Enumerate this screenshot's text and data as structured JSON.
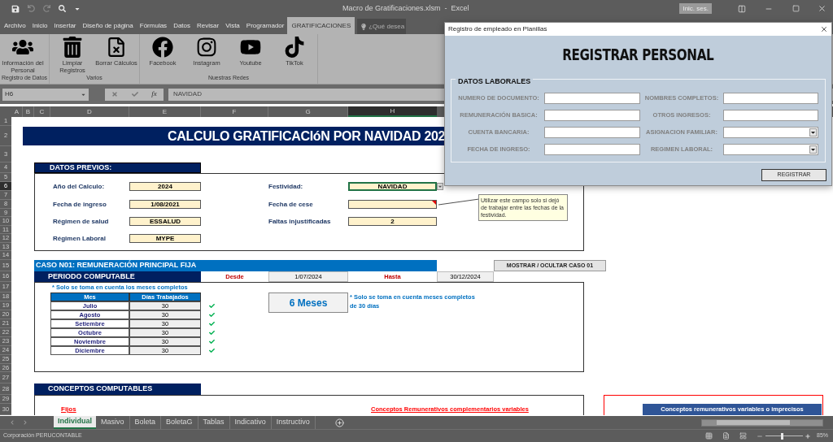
{
  "window": {
    "title": "Macro de Gratificaciones.xlsm  -  Excel",
    "sign_in": "Inic. ses."
  },
  "menu": [
    {
      "label": "Archivo",
      "selected": false
    },
    {
      "label": "Inicio",
      "selected": false
    },
    {
      "label": "Insertar",
      "selected": false
    },
    {
      "label": "Diseño de página",
      "selected": false
    },
    {
      "label": "Fórmulas",
      "selected": false
    },
    {
      "label": "Datos",
      "selected": false
    },
    {
      "label": "Revisar",
      "selected": false
    },
    {
      "label": "Vista",
      "selected": false
    },
    {
      "label": "Programador",
      "selected": false
    },
    {
      "label": "GRATIFICACIONES",
      "selected": true
    }
  ],
  "search": {
    "placeholder": "¿Qué desea"
  },
  "ribbon": [
    {
      "label": "Registro de Datos",
      "buttons": [
        {
          "label": "Información del Personal",
          "kind": "people"
        }
      ]
    },
    {
      "label": "Varios",
      "buttons": [
        {
          "label": "Limpiar Registros",
          "kind": "trash"
        },
        {
          "label": "Borrar Cálculos",
          "kind": "erase"
        }
      ]
    },
    {
      "label": "Nuestras Redes",
      "buttons": [
        {
          "label": "Facebook",
          "kind": "facebook"
        },
        {
          "label": "Instagram",
          "kind": "instagram"
        },
        {
          "label": "Youtube",
          "kind": "youtube"
        },
        {
          "label": "TikTok",
          "kind": "tiktok"
        }
      ]
    }
  ],
  "formula_bar": {
    "name_box": "H6",
    "function_label": "fx",
    "value": "NAVIDAD"
  },
  "columns": [
    {
      "label": "A",
      "selected": false
    },
    {
      "label": "B",
      "selected": false
    },
    {
      "label": "C",
      "selected": false
    },
    {
      "label": "D",
      "selected": false
    },
    {
      "label": "E",
      "selected": false
    },
    {
      "label": "F",
      "selected": false
    },
    {
      "label": "G",
      "selected": false
    },
    {
      "label": "H",
      "selected": true
    }
  ],
  "rows": [
    {
      "label": "1",
      "selected": false
    },
    {
      "label": "2",
      "selected": false
    },
    {
      "label": "3",
      "selected": false
    },
    {
      "label": "4",
      "selected": false
    },
    {
      "label": "5",
      "selected": false
    },
    {
      "label": "6",
      "selected": true
    },
    {
      "label": "7",
      "selected": false
    },
    {
      "label": "8",
      "selected": false
    },
    {
      "label": "9",
      "selected": false
    },
    {
      "label": "10",
      "selected": false
    },
    {
      "label": "11",
      "selected": false
    },
    {
      "label": "12",
      "selected": false
    },
    {
      "label": "13",
      "selected": false
    },
    {
      "label": "14",
      "selected": false
    },
    {
      "label": "15",
      "selected": false
    },
    {
      "label": "16",
      "selected": false
    },
    {
      "label": "17",
      "selected": false
    },
    {
      "label": "18",
      "selected": false
    },
    {
      "label": "19",
      "selected": false
    },
    {
      "label": "20",
      "selected": false
    },
    {
      "label": "21",
      "selected": false
    },
    {
      "label": "22",
      "selected": false
    },
    {
      "label": "23",
      "selected": false
    },
    {
      "label": "24",
      "selected": false
    },
    {
      "label": "25",
      "selected": false
    },
    {
      "label": "26",
      "selected": false
    },
    {
      "label": "27",
      "selected": false
    },
    {
      "label": "28",
      "selected": false
    },
    {
      "label": "29",
      "selected": false
    },
    {
      "label": "30",
      "selected": false
    }
  ],
  "sheet": {
    "banner": "CALCULO GRATIFICACIóN POR NAVIDAD 202",
    "datos_previos": {
      "heading": "DATOS PREVIOS:",
      "left": [
        {
          "label": "Año del Calculo:",
          "value": "2024",
          "selected": false
        },
        {
          "label": "Fecha de ingreso",
          "value": "1/08/2021",
          "selected": false
        },
        {
          "label": "Régimen de salud",
          "value": "ESSALUD",
          "selected": false
        },
        {
          "label": "Régimen Laboral",
          "value": "MYPE",
          "selected": false
        }
      ],
      "right": [
        {
          "label": "Festividad:",
          "value": "NAVIDAD",
          "selected": true,
          "dropdown": true
        },
        {
          "label": "Fecha de cese",
          "selected": false,
          "comment": "Utilizar este campo solo si dejó de trabajar entre las fechas de la festividad."
        },
        {
          "label": "Faltas injustificadas",
          "value": "2",
          "selected": false
        }
      ]
    },
    "caso": {
      "heading": "CASO N01: REMUNERACIÓN PRINCIPAL FIJA",
      "toggle_button": "MOSTRAR / OCULTAR CASO 01",
      "period_heading": "PERIODO COMPUTABLE",
      "from_label": "Desde",
      "from": "1/07/2024",
      "to_label": "Hasta",
      "to": "30/12/2024",
      "note": "* Solo se toma en cuenta los meses completos",
      "table_columns": [
        "Mes",
        "Días Trabajados"
      ],
      "table_rows": [
        {
          "month": "Julio",
          "days": "30",
          "checked": true
        },
        {
          "month": "Agosto",
          "days": "30",
          "checked": true
        },
        {
          "month": "Setiembre",
          "days": "30",
          "checked": true
        },
        {
          "month": "Octubre",
          "days": "30",
          "checked": true
        },
        {
          "month": "Noviembre",
          "days": "30",
          "checked": true
        },
        {
          "month": "Diciembre",
          "days": "30",
          "checked": true
        }
      ],
      "months_total": "6 Meses",
      "total_note": "* Solo se toma en cuenta meses completos de 30 días"
    },
    "conceptos": {
      "heading": "CONCEPTOS COMPUTABLES",
      "fixed_label": "Fijos",
      "variable_label": "Conceptos Remunerativos complementarios variables",
      "side_table_title": "Conceptos remunerativos variables o imprecisos"
    }
  },
  "sheet_tabs": [
    {
      "label": "Individual",
      "selected": true
    },
    {
      "label": "Masivo",
      "selected": false
    },
    {
      "label": "Boleta",
      "selected": false
    },
    {
      "label": "BoletaG",
      "selected": false
    },
    {
      "label": "Tablas",
      "selected": false
    },
    {
      "label": "Indicativo",
      "selected": false
    },
    {
      "label": "Instructivo",
      "selected": false
    }
  ],
  "status_bar": {
    "text": "Corporación PERUCONTABLE",
    "zoom": "85%",
    "level": 0.42
  },
  "dialog": {
    "title": "Registro de empleado en Planillas",
    "heading": "REGISTRAR PERSONAL",
    "group": "DATOS LABORALES",
    "fields": [
      {
        "label": "NUMERO DE DOCUMENTO:",
        "kind": "text"
      },
      {
        "label": "NOMBRES COMPLETOS:",
        "kind": "text"
      },
      {
        "label": "REMUNERACIÓN BASICA:",
        "kind": "text"
      },
      {
        "label": "OTROS INGRESOS:",
        "kind": "text"
      },
      {
        "label": "CUENTA BANCARIA:",
        "kind": "text"
      },
      {
        "label": "ASIGNACION FAMILIAR:",
        "kind": "combo"
      },
      {
        "label": "FECHA DE INGRESO:",
        "kind": "text"
      },
      {
        "label": "REGIMEN LABORAL:",
        "kind": "combo"
      }
    ],
    "button": "REGISTRAR"
  }
}
